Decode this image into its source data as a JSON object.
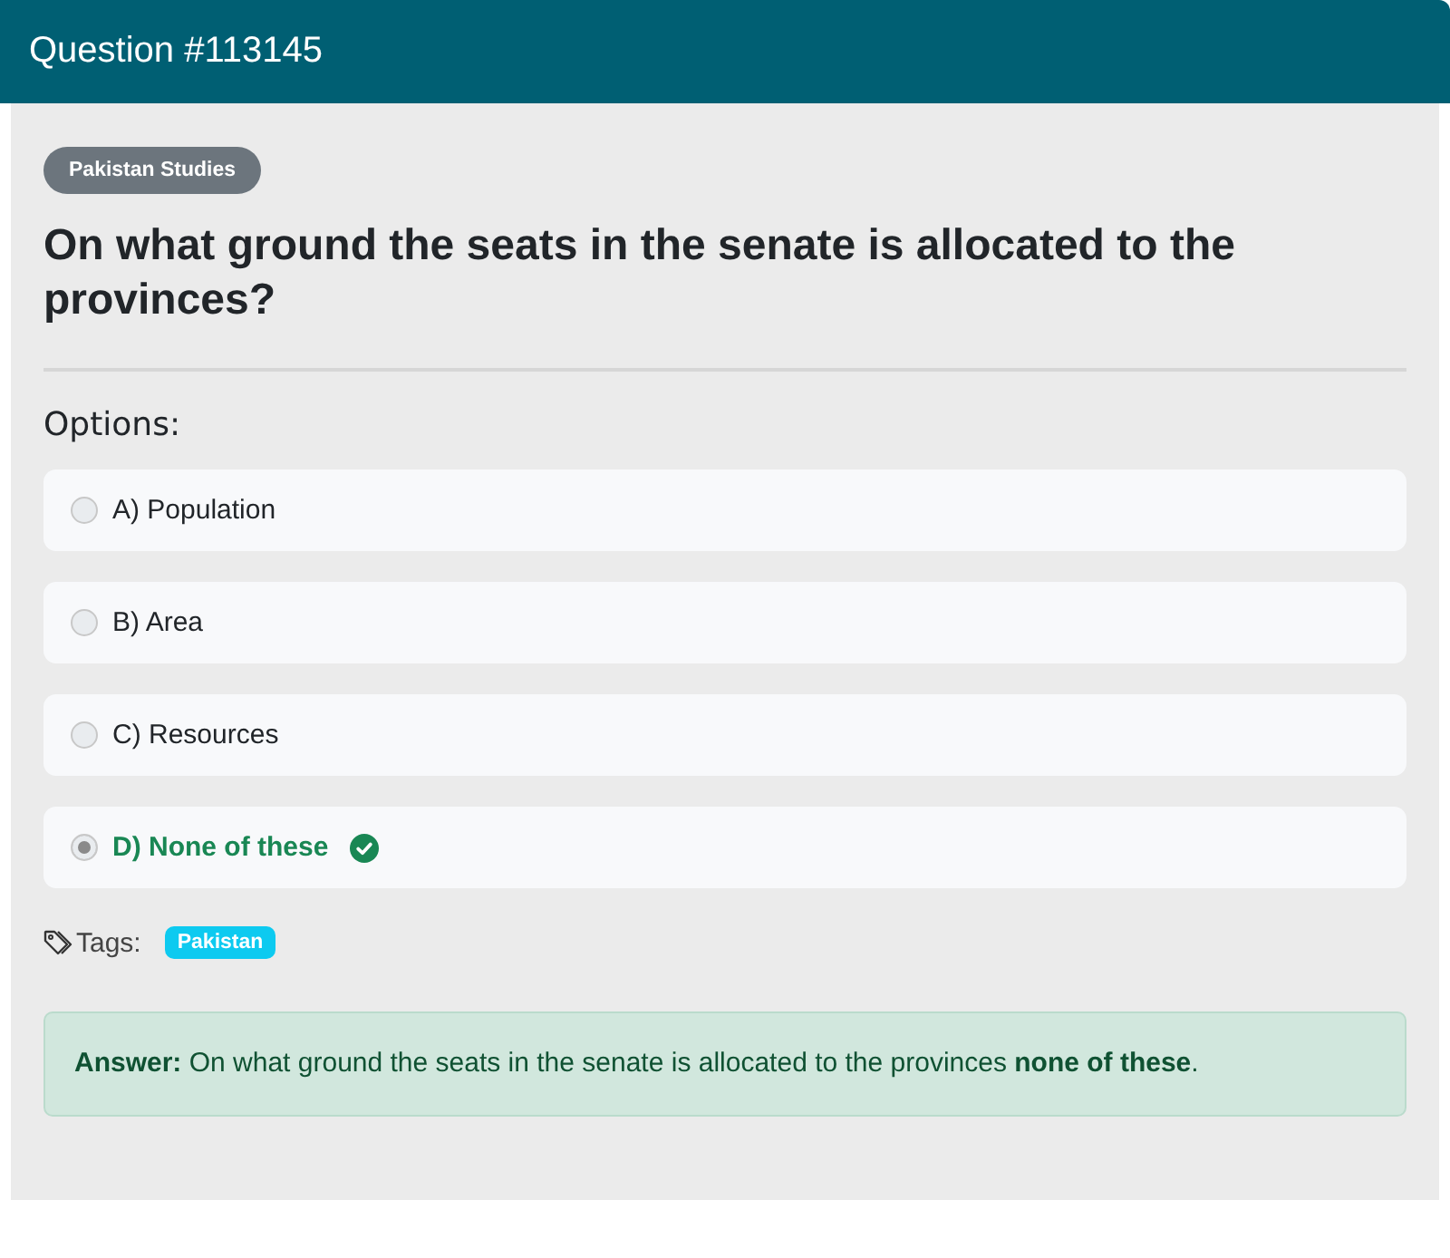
{
  "header": {
    "title": "Question #113145"
  },
  "category": {
    "label": "Pakistan Studies"
  },
  "question": {
    "text": "On what ground the seats in the senate is allocated to the provinces?"
  },
  "options_heading": "Options:",
  "options": [
    {
      "label": "A) Population",
      "selected": false,
      "correct": false
    },
    {
      "label": "B) Area",
      "selected": false,
      "correct": false
    },
    {
      "label": "C) Resources",
      "selected": false,
      "correct": false
    },
    {
      "label": "D) None of these",
      "selected": true,
      "correct": true
    }
  ],
  "tags": {
    "label": "Tags:",
    "items": [
      "Pakistan"
    ]
  },
  "answer": {
    "text": "**Answer:** On what ground the seats in the senate is allocated to the provinces **none of these**."
  }
}
